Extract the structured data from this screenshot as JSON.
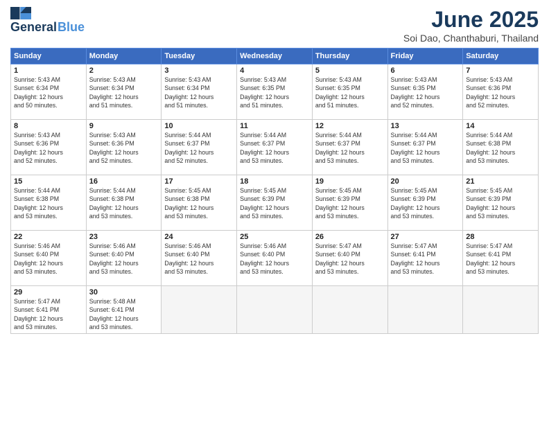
{
  "logo": {
    "line1": "General",
    "line2": "Blue"
  },
  "title": {
    "month_year": "June 2025",
    "location": "Soi Dao, Chanthaburi, Thailand"
  },
  "days_of_week": [
    "Sunday",
    "Monday",
    "Tuesday",
    "Wednesday",
    "Thursday",
    "Friday",
    "Saturday"
  ],
  "weeks": [
    [
      {
        "day": "1",
        "info": "Sunrise: 5:43 AM\nSunset: 6:34 PM\nDaylight: 12 hours\nand 50 minutes."
      },
      {
        "day": "2",
        "info": "Sunrise: 5:43 AM\nSunset: 6:34 PM\nDaylight: 12 hours\nand 51 minutes."
      },
      {
        "day": "3",
        "info": "Sunrise: 5:43 AM\nSunset: 6:34 PM\nDaylight: 12 hours\nand 51 minutes."
      },
      {
        "day": "4",
        "info": "Sunrise: 5:43 AM\nSunset: 6:35 PM\nDaylight: 12 hours\nand 51 minutes."
      },
      {
        "day": "5",
        "info": "Sunrise: 5:43 AM\nSunset: 6:35 PM\nDaylight: 12 hours\nand 51 minutes."
      },
      {
        "day": "6",
        "info": "Sunrise: 5:43 AM\nSunset: 6:35 PM\nDaylight: 12 hours\nand 52 minutes."
      },
      {
        "day": "7",
        "info": "Sunrise: 5:43 AM\nSunset: 6:36 PM\nDaylight: 12 hours\nand 52 minutes."
      }
    ],
    [
      {
        "day": "8",
        "info": "Sunrise: 5:43 AM\nSunset: 6:36 PM\nDaylight: 12 hours\nand 52 minutes."
      },
      {
        "day": "9",
        "info": "Sunrise: 5:43 AM\nSunset: 6:36 PM\nDaylight: 12 hours\nand 52 minutes."
      },
      {
        "day": "10",
        "info": "Sunrise: 5:44 AM\nSunset: 6:37 PM\nDaylight: 12 hours\nand 52 minutes."
      },
      {
        "day": "11",
        "info": "Sunrise: 5:44 AM\nSunset: 6:37 PM\nDaylight: 12 hours\nand 53 minutes."
      },
      {
        "day": "12",
        "info": "Sunrise: 5:44 AM\nSunset: 6:37 PM\nDaylight: 12 hours\nand 53 minutes."
      },
      {
        "day": "13",
        "info": "Sunrise: 5:44 AM\nSunset: 6:37 PM\nDaylight: 12 hours\nand 53 minutes."
      },
      {
        "day": "14",
        "info": "Sunrise: 5:44 AM\nSunset: 6:38 PM\nDaylight: 12 hours\nand 53 minutes."
      }
    ],
    [
      {
        "day": "15",
        "info": "Sunrise: 5:44 AM\nSunset: 6:38 PM\nDaylight: 12 hours\nand 53 minutes."
      },
      {
        "day": "16",
        "info": "Sunrise: 5:44 AM\nSunset: 6:38 PM\nDaylight: 12 hours\nand 53 minutes."
      },
      {
        "day": "17",
        "info": "Sunrise: 5:45 AM\nSunset: 6:38 PM\nDaylight: 12 hours\nand 53 minutes."
      },
      {
        "day": "18",
        "info": "Sunrise: 5:45 AM\nSunset: 6:39 PM\nDaylight: 12 hours\nand 53 minutes."
      },
      {
        "day": "19",
        "info": "Sunrise: 5:45 AM\nSunset: 6:39 PM\nDaylight: 12 hours\nand 53 minutes."
      },
      {
        "day": "20",
        "info": "Sunrise: 5:45 AM\nSunset: 6:39 PM\nDaylight: 12 hours\nand 53 minutes."
      },
      {
        "day": "21",
        "info": "Sunrise: 5:45 AM\nSunset: 6:39 PM\nDaylight: 12 hours\nand 53 minutes."
      }
    ],
    [
      {
        "day": "22",
        "info": "Sunrise: 5:46 AM\nSunset: 6:40 PM\nDaylight: 12 hours\nand 53 minutes."
      },
      {
        "day": "23",
        "info": "Sunrise: 5:46 AM\nSunset: 6:40 PM\nDaylight: 12 hours\nand 53 minutes."
      },
      {
        "day": "24",
        "info": "Sunrise: 5:46 AM\nSunset: 6:40 PM\nDaylight: 12 hours\nand 53 minutes."
      },
      {
        "day": "25",
        "info": "Sunrise: 5:46 AM\nSunset: 6:40 PM\nDaylight: 12 hours\nand 53 minutes."
      },
      {
        "day": "26",
        "info": "Sunrise: 5:47 AM\nSunset: 6:40 PM\nDaylight: 12 hours\nand 53 minutes."
      },
      {
        "day": "27",
        "info": "Sunrise: 5:47 AM\nSunset: 6:41 PM\nDaylight: 12 hours\nand 53 minutes."
      },
      {
        "day": "28",
        "info": "Sunrise: 5:47 AM\nSunset: 6:41 PM\nDaylight: 12 hours\nand 53 minutes."
      }
    ],
    [
      {
        "day": "29",
        "info": "Sunrise: 5:47 AM\nSunset: 6:41 PM\nDaylight: 12 hours\nand 53 minutes."
      },
      {
        "day": "30",
        "info": "Sunrise: 5:48 AM\nSunset: 6:41 PM\nDaylight: 12 hours\nand 53 minutes."
      },
      {
        "day": "",
        "info": ""
      },
      {
        "day": "",
        "info": ""
      },
      {
        "day": "",
        "info": ""
      },
      {
        "day": "",
        "info": ""
      },
      {
        "day": "",
        "info": ""
      }
    ]
  ]
}
